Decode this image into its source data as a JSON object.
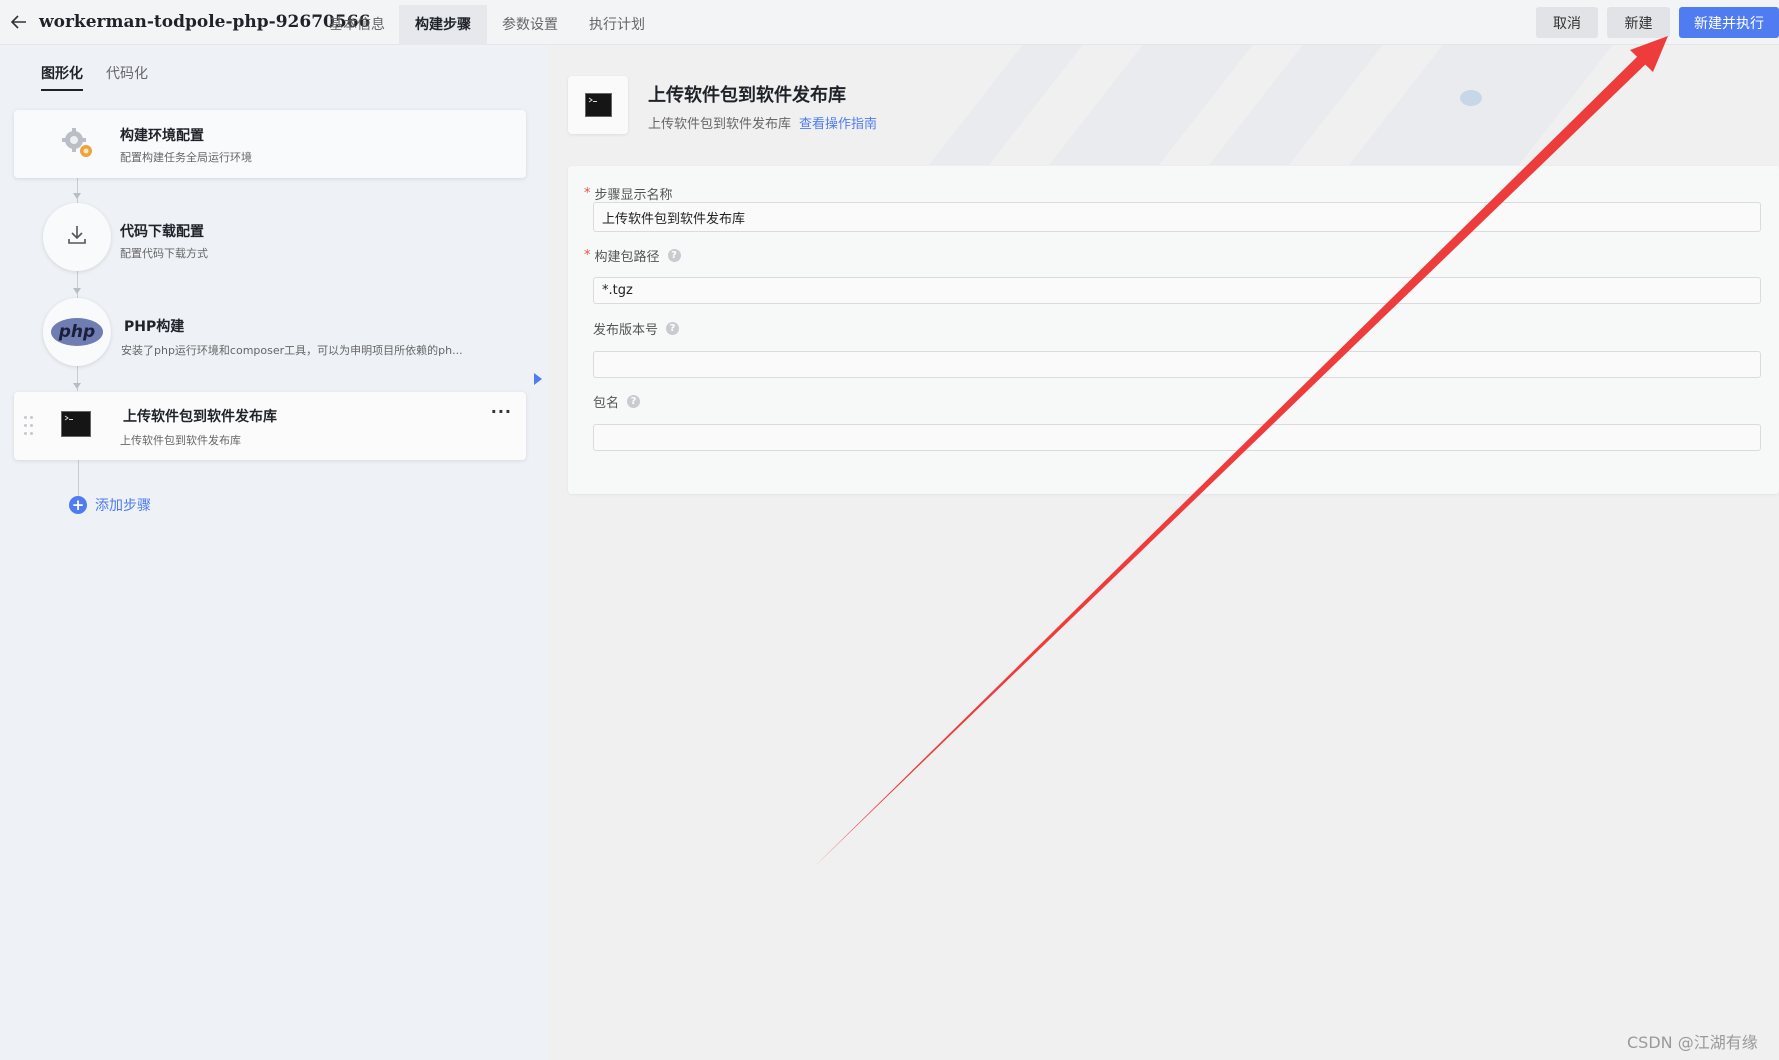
{
  "header": {
    "title": "workerman-todpole-php-92670566",
    "tabs": [
      {
        "label": "基本信息",
        "active": false
      },
      {
        "label": "构建步骤",
        "active": true
      },
      {
        "label": "参数设置",
        "active": false
      },
      {
        "label": "执行计划",
        "active": false
      }
    ],
    "buttons": {
      "cancel": "取消",
      "new": "新建",
      "new_and_run": "新建并执行"
    },
    "colors": {
      "primary": "#4f7cf0"
    }
  },
  "left": {
    "subtabs": [
      {
        "label": "图形化",
        "active": true
      },
      {
        "label": "代码化",
        "active": false
      }
    ],
    "steps": [
      {
        "title": "构建环境配置",
        "desc": "配置构建任务全局运行环境",
        "icon": "gear-icon"
      },
      {
        "title": "代码下载配置",
        "desc": "配置代码下载方式",
        "icon": "download-icon"
      },
      {
        "title": "PHP构建",
        "desc": "安装了php运行环境和composer工具，可以为申明项目所依赖的ph...",
        "icon": "php-logo-icon",
        "icon_text": "php"
      },
      {
        "title": "上传软件包到软件发布库",
        "desc": "上传软件包到软件发布库",
        "icon": "terminal-icon",
        "selected": true
      }
    ],
    "add_step_label": "添加步骤"
  },
  "plugin": {
    "title": "上传软件包到软件发布库",
    "desc": "上传软件包到软件发布库",
    "guide_link": "查看操作指南",
    "icon": "terminal-icon"
  },
  "form": {
    "fields": [
      {
        "label": "步骤显示名称",
        "required": true,
        "help": false,
        "value": "上传软件包到软件发布库"
      },
      {
        "label": "构建包路径",
        "required": true,
        "help": true,
        "value": "*.tgz"
      },
      {
        "label": "发布版本号",
        "required": false,
        "help": true,
        "value": ""
      },
      {
        "label": "包名",
        "required": false,
        "help": true,
        "value": ""
      }
    ],
    "help_glyph": "?"
  },
  "annotation": {
    "arrow_color": "#ee3b3b"
  },
  "watermark": "CSDN @江湖有缘"
}
